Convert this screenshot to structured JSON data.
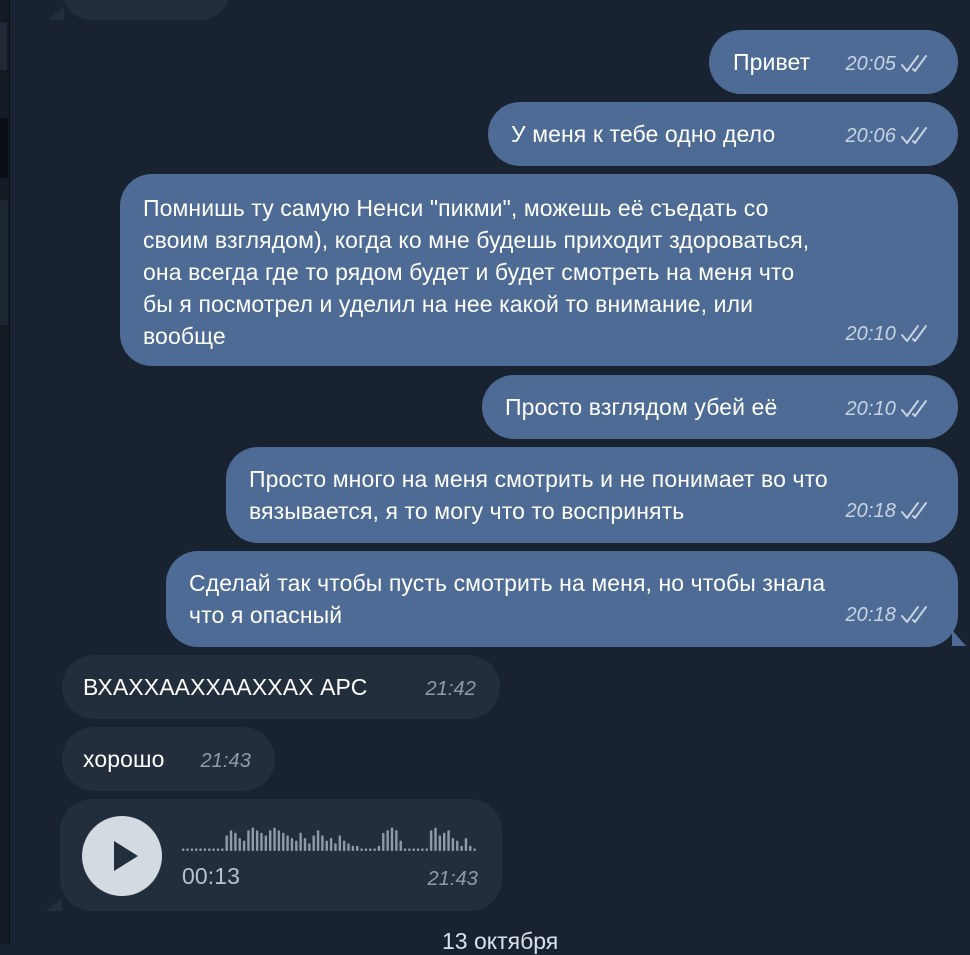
{
  "colors": {
    "background": "#182230",
    "outgoing_bubble": "#4d6b94",
    "incoming_bubble": "#232e3c",
    "read_checkmarks": "#c7d3e2"
  },
  "top_partial_message": {
    "status": "partially visible, cut off at top edge"
  },
  "messages": [
    {
      "direction": "outgoing",
      "text": "Привет",
      "time": "20:05",
      "status_icon": "double-check-icon"
    },
    {
      "direction": "outgoing",
      "text": "У меня к тебе одно дело",
      "time": "20:06",
      "status_icon": "double-check-icon"
    },
    {
      "direction": "outgoing",
      "lines": [
        "Помнишь ту самую Ненси \"пикми\", можешь её съедать со",
        "своим взглядом), когда ко мне будешь приходит здороваться,",
        "она всегда где то рядом будет и будет смотреть на меня что",
        "бы я посмотрел и уделил на нее какой то внимание, или",
        "вообще"
      ],
      "time": "20:10",
      "status_icon": "double-check-icon"
    },
    {
      "direction": "outgoing",
      "text": "Просто взглядом убей её",
      "time": "20:10",
      "status_icon": "double-check-icon"
    },
    {
      "direction": "outgoing",
      "lines": [
        "Просто много на меня смотрить и не понимает во что",
        "вязывается, я то могу что то воспринять"
      ],
      "time": "20:18",
      "status_icon": "double-check-icon"
    },
    {
      "direction": "outgoing",
      "lines": [
        "Сделай так чтобы пусть смотрить на меня, но чтобы знала",
        "что я опасный"
      ],
      "time": "20:18",
      "status_icon": "double-check-icon"
    },
    {
      "direction": "incoming",
      "text": "ВХАХХААХХААХХАХ АРС",
      "time": "21:42"
    },
    {
      "direction": "incoming",
      "text": "хорошо",
      "time": "21:43"
    }
  ],
  "voice_message": {
    "direction": "incoming",
    "play_icon": "play-icon",
    "duration": "00:13",
    "time": "21:43"
  },
  "date_separator": "13 октября"
}
